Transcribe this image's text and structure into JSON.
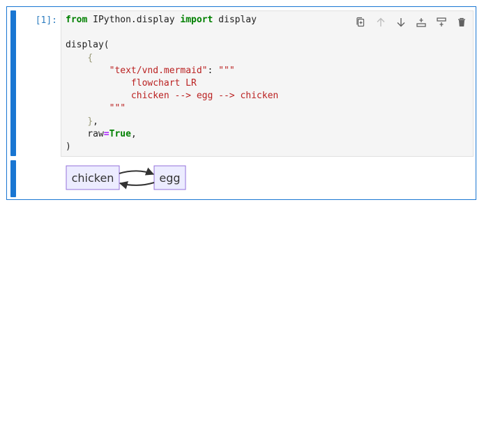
{
  "cell": {
    "prompt": "[1]:",
    "code_lines": [
      [
        {
          "t": "from",
          "c": "kw"
        },
        {
          "t": " IPython.display ",
          "c": ""
        },
        {
          "t": "import",
          "c": "kw"
        },
        {
          "t": " display",
          "c": ""
        }
      ],
      [],
      [
        {
          "t": "display(",
          "c": ""
        }
      ],
      [
        {
          "t": "    ",
          "c": ""
        },
        {
          "t": "{",
          "c": "brace"
        }
      ],
      [
        {
          "t": "        ",
          "c": ""
        },
        {
          "t": "\"text/vnd.mermaid\"",
          "c": "str"
        },
        {
          "t": ": ",
          "c": ""
        },
        {
          "t": "\"\"\"",
          "c": "str"
        }
      ],
      [
        {
          "t": "            flowchart LR",
          "c": "str"
        }
      ],
      [
        {
          "t": "            chicken --> egg --> chicken",
          "c": "str"
        }
      ],
      [
        {
          "t": "        \"\"\"",
          "c": "str"
        }
      ],
      [
        {
          "t": "    ",
          "c": ""
        },
        {
          "t": "}",
          "c": "brace"
        },
        {
          "t": ",",
          "c": ""
        }
      ],
      [
        {
          "t": "    raw",
          "c": ""
        },
        {
          "t": "=",
          "c": "op"
        },
        {
          "t": "True",
          "c": "kw"
        },
        {
          "t": ",",
          "c": ""
        }
      ],
      [
        {
          "t": ")",
          "c": ""
        }
      ]
    ]
  },
  "toolbar": {
    "buttons": [
      {
        "name": "duplicate-cell-button",
        "icon": "copy-icon"
      },
      {
        "name": "move-up-button",
        "icon": "arrow-up-icon"
      },
      {
        "name": "move-down-button",
        "icon": "arrow-down-icon"
      },
      {
        "name": "insert-above-button",
        "icon": "insert-above-icon"
      },
      {
        "name": "insert-below-button",
        "icon": "insert-below-icon"
      },
      {
        "name": "delete-cell-button",
        "icon": "trash-icon"
      }
    ],
    "icon_color": "#616161",
    "disabled_color": "#bdbdbd"
  },
  "output": {
    "nodes": {
      "chicken": "chicken",
      "egg": "egg"
    },
    "node_fill": "#ECECFF",
    "node_stroke": "#9370DB",
    "edge_color": "#333333"
  },
  "colors": {
    "accent": "#1976d2",
    "prompt": "#307fc1"
  }
}
